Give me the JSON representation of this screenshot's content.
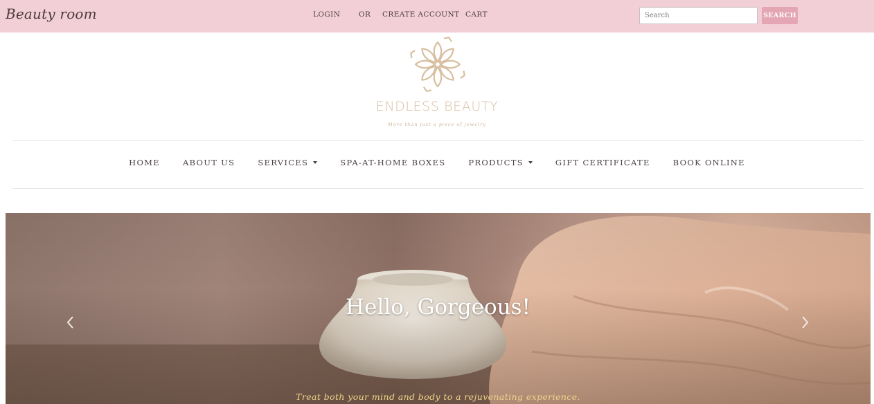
{
  "header": {
    "brand": "Beauty room",
    "login": "LOGIN",
    "or": "OR",
    "create_account": "CREATE ACCOUNT",
    "cart": "CART",
    "search_placeholder": "Search",
    "search_button": "SEARCH"
  },
  "logo": {
    "title": "ENDLESS BEAUTY",
    "tagline": "More than just a piece of jewelry",
    "icon": "lotus-mandala-icon"
  },
  "nav": {
    "items": [
      {
        "label": "HOME",
        "dropdown": false
      },
      {
        "label": "ABOUT US",
        "dropdown": false
      },
      {
        "label": "SERVICES",
        "dropdown": true
      },
      {
        "label": "SPA-AT-HOME BOXES",
        "dropdown": false
      },
      {
        "label": "PRODUCTS",
        "dropdown": true
      },
      {
        "label": "GIFT CERTIFICATE",
        "dropdown": false
      },
      {
        "label": "BOOK ONLINE",
        "dropdown": false
      }
    ]
  },
  "hero": {
    "title": "Hello, Gorgeous!",
    "subtitle": "Treat both your mind and body to a rejuvenating experience.",
    "prev_icon": "chevron-left-icon",
    "next_icon": "chevron-right-icon"
  },
  "colors": {
    "topbar": "#f2cfd6",
    "search_button": "#e4a6b3",
    "logo_gold": "#d8bfa1",
    "hero_subtitle": "#f0d48a"
  }
}
